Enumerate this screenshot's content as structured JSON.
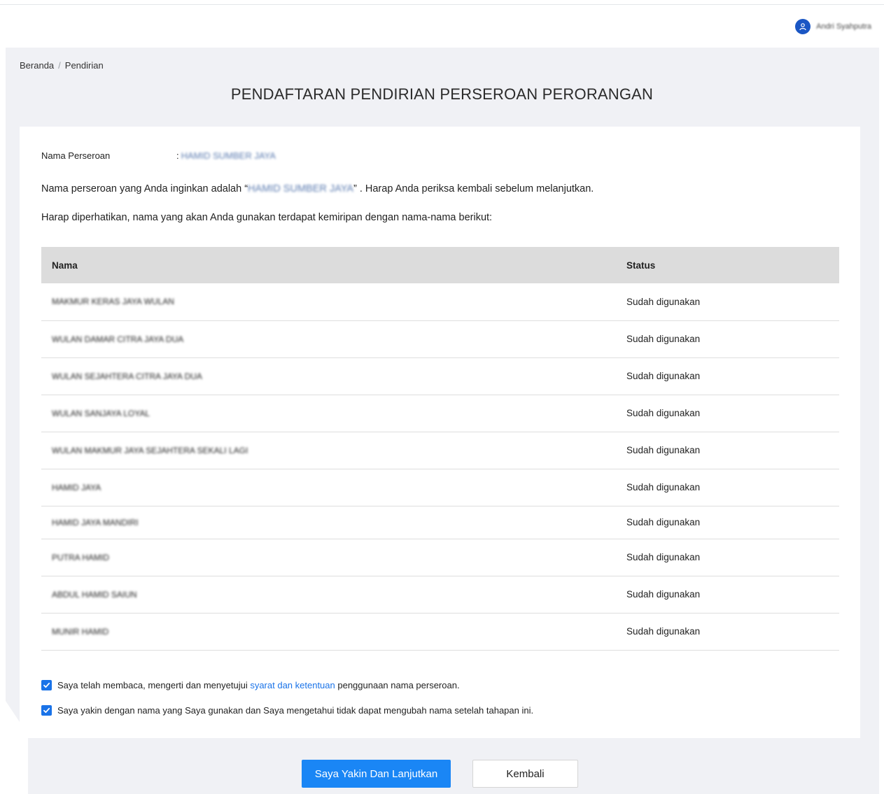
{
  "header": {
    "user_name": "Andri Syahputra",
    "avatar_icon": "user-icon"
  },
  "breadcrumb": {
    "home": "Beranda",
    "separator": "/",
    "current": "Pendirian"
  },
  "page": {
    "title": "PENDAFTARAN PENDIRIAN PERSEROAN PERORANGAN"
  },
  "company": {
    "label": "Nama Perseroan",
    "separator": ":",
    "value": "HAMID SUMBER JAYA"
  },
  "confirmation": {
    "prefix": "Nama perseroan yang Anda inginkan adalah “",
    "name": "HAMID SUMBER JAYA",
    "suffix": "” . Harap Anda periksa kembali sebelum melanjutkan."
  },
  "similarity_note": "Harap diperhatikan, nama yang akan Anda gunakan terdapat kemiripan dengan nama-nama berikut:",
  "table": {
    "headers": [
      "Nama",
      "Status"
    ],
    "rows": [
      {
        "name": "MAKMUR KERAS JAYA WULAN",
        "status": "Sudah digunakan"
      },
      {
        "name": "WULAN DAMAR CITRA JAYA DUA",
        "status": "Sudah digunakan"
      },
      {
        "name": "WULAN SEJAHTERA CITRA JAYA DUA",
        "status": "Sudah digunakan"
      },
      {
        "name": "WULAN SANJAYA LOYAL",
        "status": "Sudah digunakan"
      },
      {
        "name": "WULAN MAKMUR JAYA SEJAHTERA SEKALI LAGI",
        "status": "Sudah digunakan"
      },
      {
        "name": "HAMID JAYA",
        "status": "Sudah digunakan"
      },
      {
        "name": "HAMID JAYA MANDIRI",
        "status": "Sudah digunakan"
      },
      {
        "name": "PUTRA HAMID",
        "status": "Sudah digunakan"
      },
      {
        "name": "ABDUL HAMID SAIUN",
        "status": "Sudah digunakan"
      },
      {
        "name": "MUNIR HAMID",
        "status": "Sudah digunakan"
      }
    ]
  },
  "agreements": {
    "terms_prefix": "Saya telah membaca, mengerti dan menyetujui ",
    "terms_link": "syarat dan ketentuan",
    "terms_suffix": " penggunaan nama perseroan.",
    "terms_checked": true,
    "certainty": "Saya yakin dengan nama yang Saya gunakan dan Saya mengetahui tidak dapat mengubah nama setelah tahapan ini.",
    "certainty_checked": true
  },
  "buttons": {
    "continue": "Saya Yakin Dan Lanjutkan",
    "back": "Kembali"
  },
  "colors": {
    "primary": "#1a86f5",
    "link": "#1a73e8",
    "avatar": "#1a56c4",
    "background": "#f0f1f5"
  }
}
